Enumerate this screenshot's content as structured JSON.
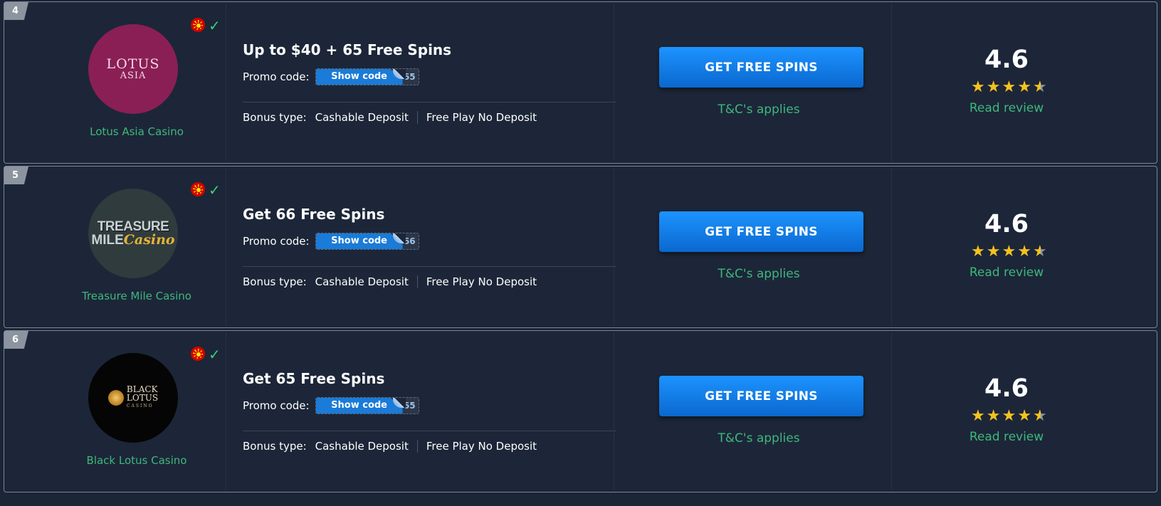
{
  "offers": [
    {
      "rank": "4",
      "casino_name": "Lotus Asia Casino",
      "logo": {
        "line1": "LOTUS",
        "line2": "ASIA"
      },
      "title": "Up to $40 + 65 Free Spins",
      "promo_label": "Promo code:",
      "show_code_label": "Show code",
      "code_peek": "65",
      "bonus_type_label": "Bonus type:",
      "bonus_tags": [
        "Cashable Deposit",
        "Free Play No Deposit"
      ],
      "cta_label": "GET FREE SPINS",
      "terms_label": "T&C's applies",
      "rating": "4.6",
      "rating_stars": 4.6,
      "review_label": "Read review"
    },
    {
      "rank": "5",
      "casino_name": "Treasure Mile Casino",
      "logo": {
        "line1": "TREASURE",
        "line2": "MILE",
        "line3": "Casino"
      },
      "title": "Get 66 Free Spins",
      "promo_label": "Promo code:",
      "show_code_label": "Show code",
      "code_peek": "66",
      "bonus_type_label": "Bonus type:",
      "bonus_tags": [
        "Cashable Deposit",
        "Free Play No Deposit"
      ],
      "cta_label": "GET FREE SPINS",
      "terms_label": "T&C's applies",
      "rating": "4.6",
      "rating_stars": 4.6,
      "review_label": "Read review"
    },
    {
      "rank": "6",
      "casino_name": "Black Lotus Casino",
      "logo": {
        "line1": "BLACK",
        "line2": "LOTUS",
        "line3": "CASINO"
      },
      "title": "Get 65 Free Spins",
      "promo_label": "Promo code:",
      "show_code_label": "Show code",
      "code_peek": "65",
      "bonus_type_label": "Bonus type:",
      "bonus_tags": [
        "Cashable Deposit",
        "Free Play No Deposit"
      ],
      "cta_label": "GET FREE SPINS",
      "terms_label": "T&C's applies",
      "rating": "4.6",
      "rating_stars": 4.6,
      "review_label": "Read review"
    }
  ],
  "icons": {
    "flag": "north-macedonia-flag-icon",
    "verified": "checkmark-icon",
    "star": "star-icon"
  },
  "colors": {
    "background": "#1b2536",
    "accent_green": "#3fb77c",
    "button_blue": "#0f7be8",
    "star_gold": "#f6c220"
  }
}
